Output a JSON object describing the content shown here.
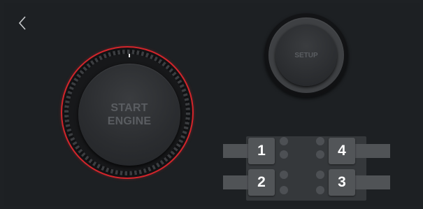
{
  "nav": {
    "back_icon": "chevron-left-icon"
  },
  "engine": {
    "label": "START\nENGINE",
    "ring_color": "#d3252b"
  },
  "setup": {
    "label": "SETUP"
  },
  "slots": [
    {
      "id": "1",
      "label": "1"
    },
    {
      "id": "2",
      "label": "2"
    },
    {
      "id": "3",
      "label": "3"
    },
    {
      "id": "4",
      "label": "4"
    }
  ],
  "colors": {
    "background": "#1d2023",
    "panel": "#35383b",
    "slot_button": "#525558",
    "label_muted": "#5a5d61",
    "accent_red": "#d3252b"
  }
}
